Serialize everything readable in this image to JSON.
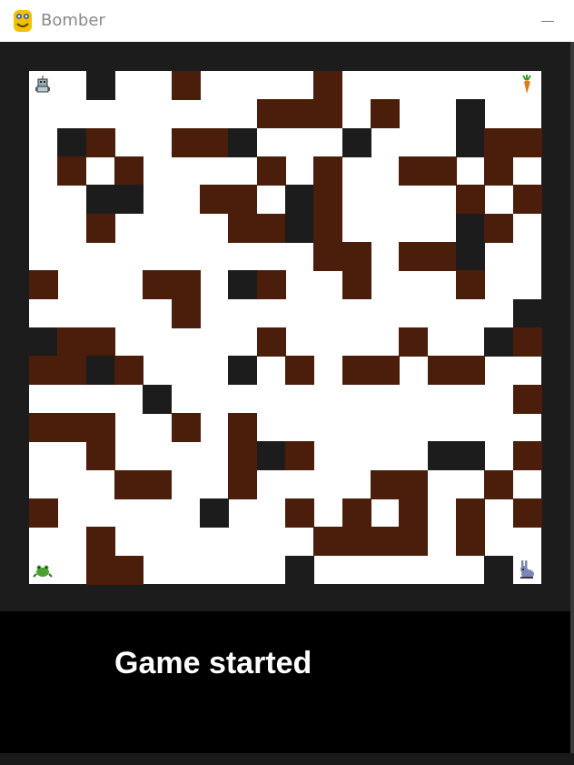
{
  "window": {
    "title": "Bomber",
    "icon": "python-icon",
    "minimize_icon": "minimize-icon"
  },
  "status": {
    "message": "Game started"
  },
  "colors": {
    "frame": "#1c1c1c",
    "floor": "#ffffff",
    "wall": "#1c1c1c",
    "crate": "#4a1e0a",
    "status_bg": "#000000",
    "status_text": "#ffffff"
  },
  "board": {
    "columns": 18,
    "rows": 18,
    "legend": {
      ".": "floor",
      "#": "wall",
      "B": "crate"
    },
    "grid": [
      "..#..B....B.......",
      "........BBB.B..#..",
      ".#B..BB#...#...#BB",
      ".B.B....B.B..BB.B.",
      "..##..BB.#B....B.B",
      "..B....BB#B....#B.",
      "..........BB.BB#..",
      "B...BB.#B..B...B..",
      ".....B...........#",
      "#BB.....B....B..#B",
      "BB#B...#.B.BB.BB..",
      "....#............B",
      "BBB..B.B..........",
      "..B....B#B....##.B",
      "...BB..B....BB..B.",
      "B.....#..B.B.B.B.B",
      "..B.......BBBB.B..",
      "..BB.....#......#."
    ],
    "players": [
      {
        "name": "player-1",
        "icon": "robot-icon",
        "row": 0,
        "col": 0
      },
      {
        "name": "player-2",
        "icon": "carrot-icon",
        "row": 0,
        "col": 17
      },
      {
        "name": "player-3",
        "icon": "frog-icon",
        "row": 17,
        "col": 0
      },
      {
        "name": "player-4",
        "icon": "rabbit-icon",
        "row": 17,
        "col": 17
      }
    ]
  }
}
